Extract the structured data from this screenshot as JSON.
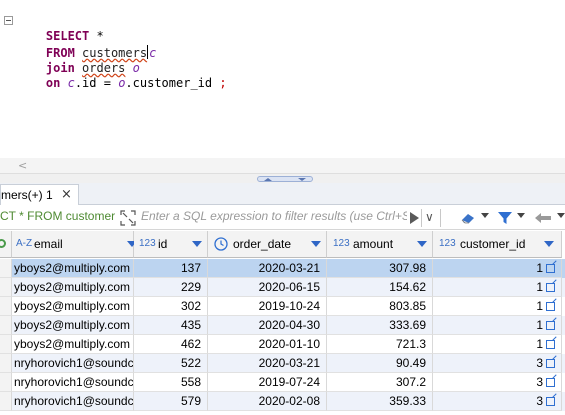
{
  "editor": {
    "line1": {
      "kw": "SELECT",
      "rest": " *"
    },
    "line2": {
      "kw": "FROM",
      "table": "customers",
      "alias": "c"
    },
    "line3": {
      "kw": "join",
      "table": "orders",
      "alias": "o"
    },
    "line4": {
      "kw": "on",
      "a1": "c",
      "mid1": ".id = ",
      "a2": "o",
      "mid2": ".customer_id ",
      "end": ";"
    }
  },
  "tab": {
    "label": "mers(+) 1",
    "close": "×"
  },
  "filterbar": {
    "sql_text": "CT * FROM customer",
    "placeholder": "Enter a SQL expression to filter results (use Ctrl+Sp",
    "history_glyph": "∨"
  },
  "grid": {
    "columns": [
      {
        "type_label": "A-Z",
        "name": "email"
      },
      {
        "type_label": "123",
        "name": "id"
      },
      {
        "type_label": "",
        "name": "order_date"
      },
      {
        "type_label": "123",
        "name": "amount"
      },
      {
        "type_label": "123",
        "name": "customer_id"
      }
    ],
    "rows": [
      {
        "email": "yboys2@multiply.com",
        "id": "137",
        "order_date": "2020-03-21",
        "amount": "307.98",
        "customer_id": "1",
        "selected": true
      },
      {
        "email": "yboys2@multiply.com",
        "id": "229",
        "order_date": "2020-06-15",
        "amount": "154.62",
        "customer_id": "1"
      },
      {
        "email": "yboys2@multiply.com",
        "id": "302",
        "order_date": "2019-10-24",
        "amount": "803.85",
        "customer_id": "1"
      },
      {
        "email": "yboys2@multiply.com",
        "id": "435",
        "order_date": "2020-04-30",
        "amount": "333.69",
        "customer_id": "1"
      },
      {
        "email": "yboys2@multiply.com",
        "id": "462",
        "order_date": "2020-01-10",
        "amount": "721.3",
        "customer_id": "1"
      },
      {
        "email": "nryhorovich1@soundc",
        "id": "522",
        "order_date": "2020-03-21",
        "amount": "90.49",
        "customer_id": "3"
      },
      {
        "email": "nryhorovich1@soundc",
        "id": "558",
        "order_date": "2019-07-24",
        "amount": "307.2",
        "customer_id": "3"
      },
      {
        "email": "nryhorovich1@soundc",
        "id": "579",
        "order_date": "2020-02-08",
        "amount": "359.33",
        "customer_id": "3"
      }
    ]
  },
  "colors": {
    "keyword": "#7f0055",
    "alias": "#7a2ba8",
    "sql_text": "#4e8a32",
    "selected_row": "#bcd4f0",
    "link_icon": "#2f6fd1"
  }
}
